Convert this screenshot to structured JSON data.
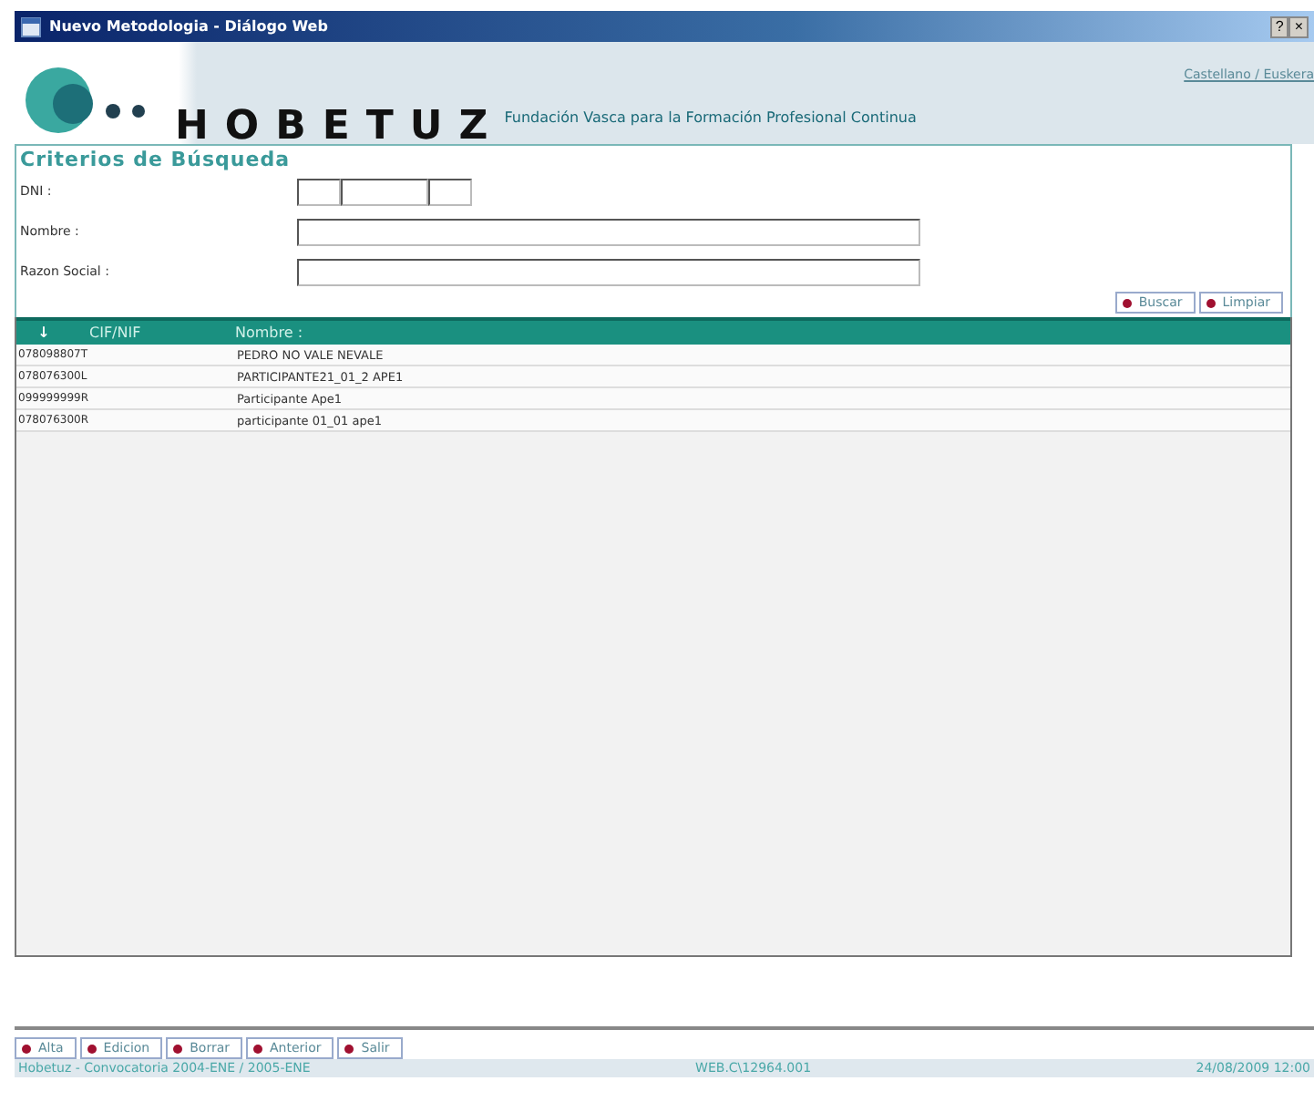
{
  "window": {
    "title": "Nuevo Metodologia - Diálogo Web",
    "controls": [
      "?",
      "×"
    ]
  },
  "header": {
    "logo": "HOBETUZ",
    "subtitle": "Fundación Vasca para la Formación Profesional Continua",
    "language_link": "Castellano / Euskera"
  },
  "criteria": {
    "title": "Criterios de Búsqueda",
    "fields": [
      {
        "label": "DNI :",
        "kind": "dni"
      },
      {
        "label": "Nombre :",
        "kind": "text"
      },
      {
        "label": "Razon Social :",
        "kind": "text"
      }
    ],
    "buttons": [
      "Buscar",
      "Limpiar"
    ]
  },
  "table": {
    "sort_icon": "↓",
    "columns": [
      "CIF/NIF",
      "Nombre :"
    ],
    "rows": [
      {
        "cells": [
          "078098807T",
          "PEDRO NO VALE NEVALE"
        ]
      },
      {
        "cells": [
          "078076300L",
          "PARTICIPANTE21_01_2 APE1"
        ]
      },
      {
        "cells": [
          "099999999R",
          "Participante Ape1"
        ]
      },
      {
        "cells": [
          "078076300R",
          "participante 01_01 ape1"
        ]
      }
    ]
  },
  "toolbar": [
    "Alta",
    "Edicion",
    "Borrar",
    "Anterior",
    "Salir"
  ],
  "status_bar": [
    "Hobetuz - Convocatoria 2004-ENE / 2005-ENE",
    "WEB.C\\12964.001",
    "24/08/2009 12:00"
  ]
}
